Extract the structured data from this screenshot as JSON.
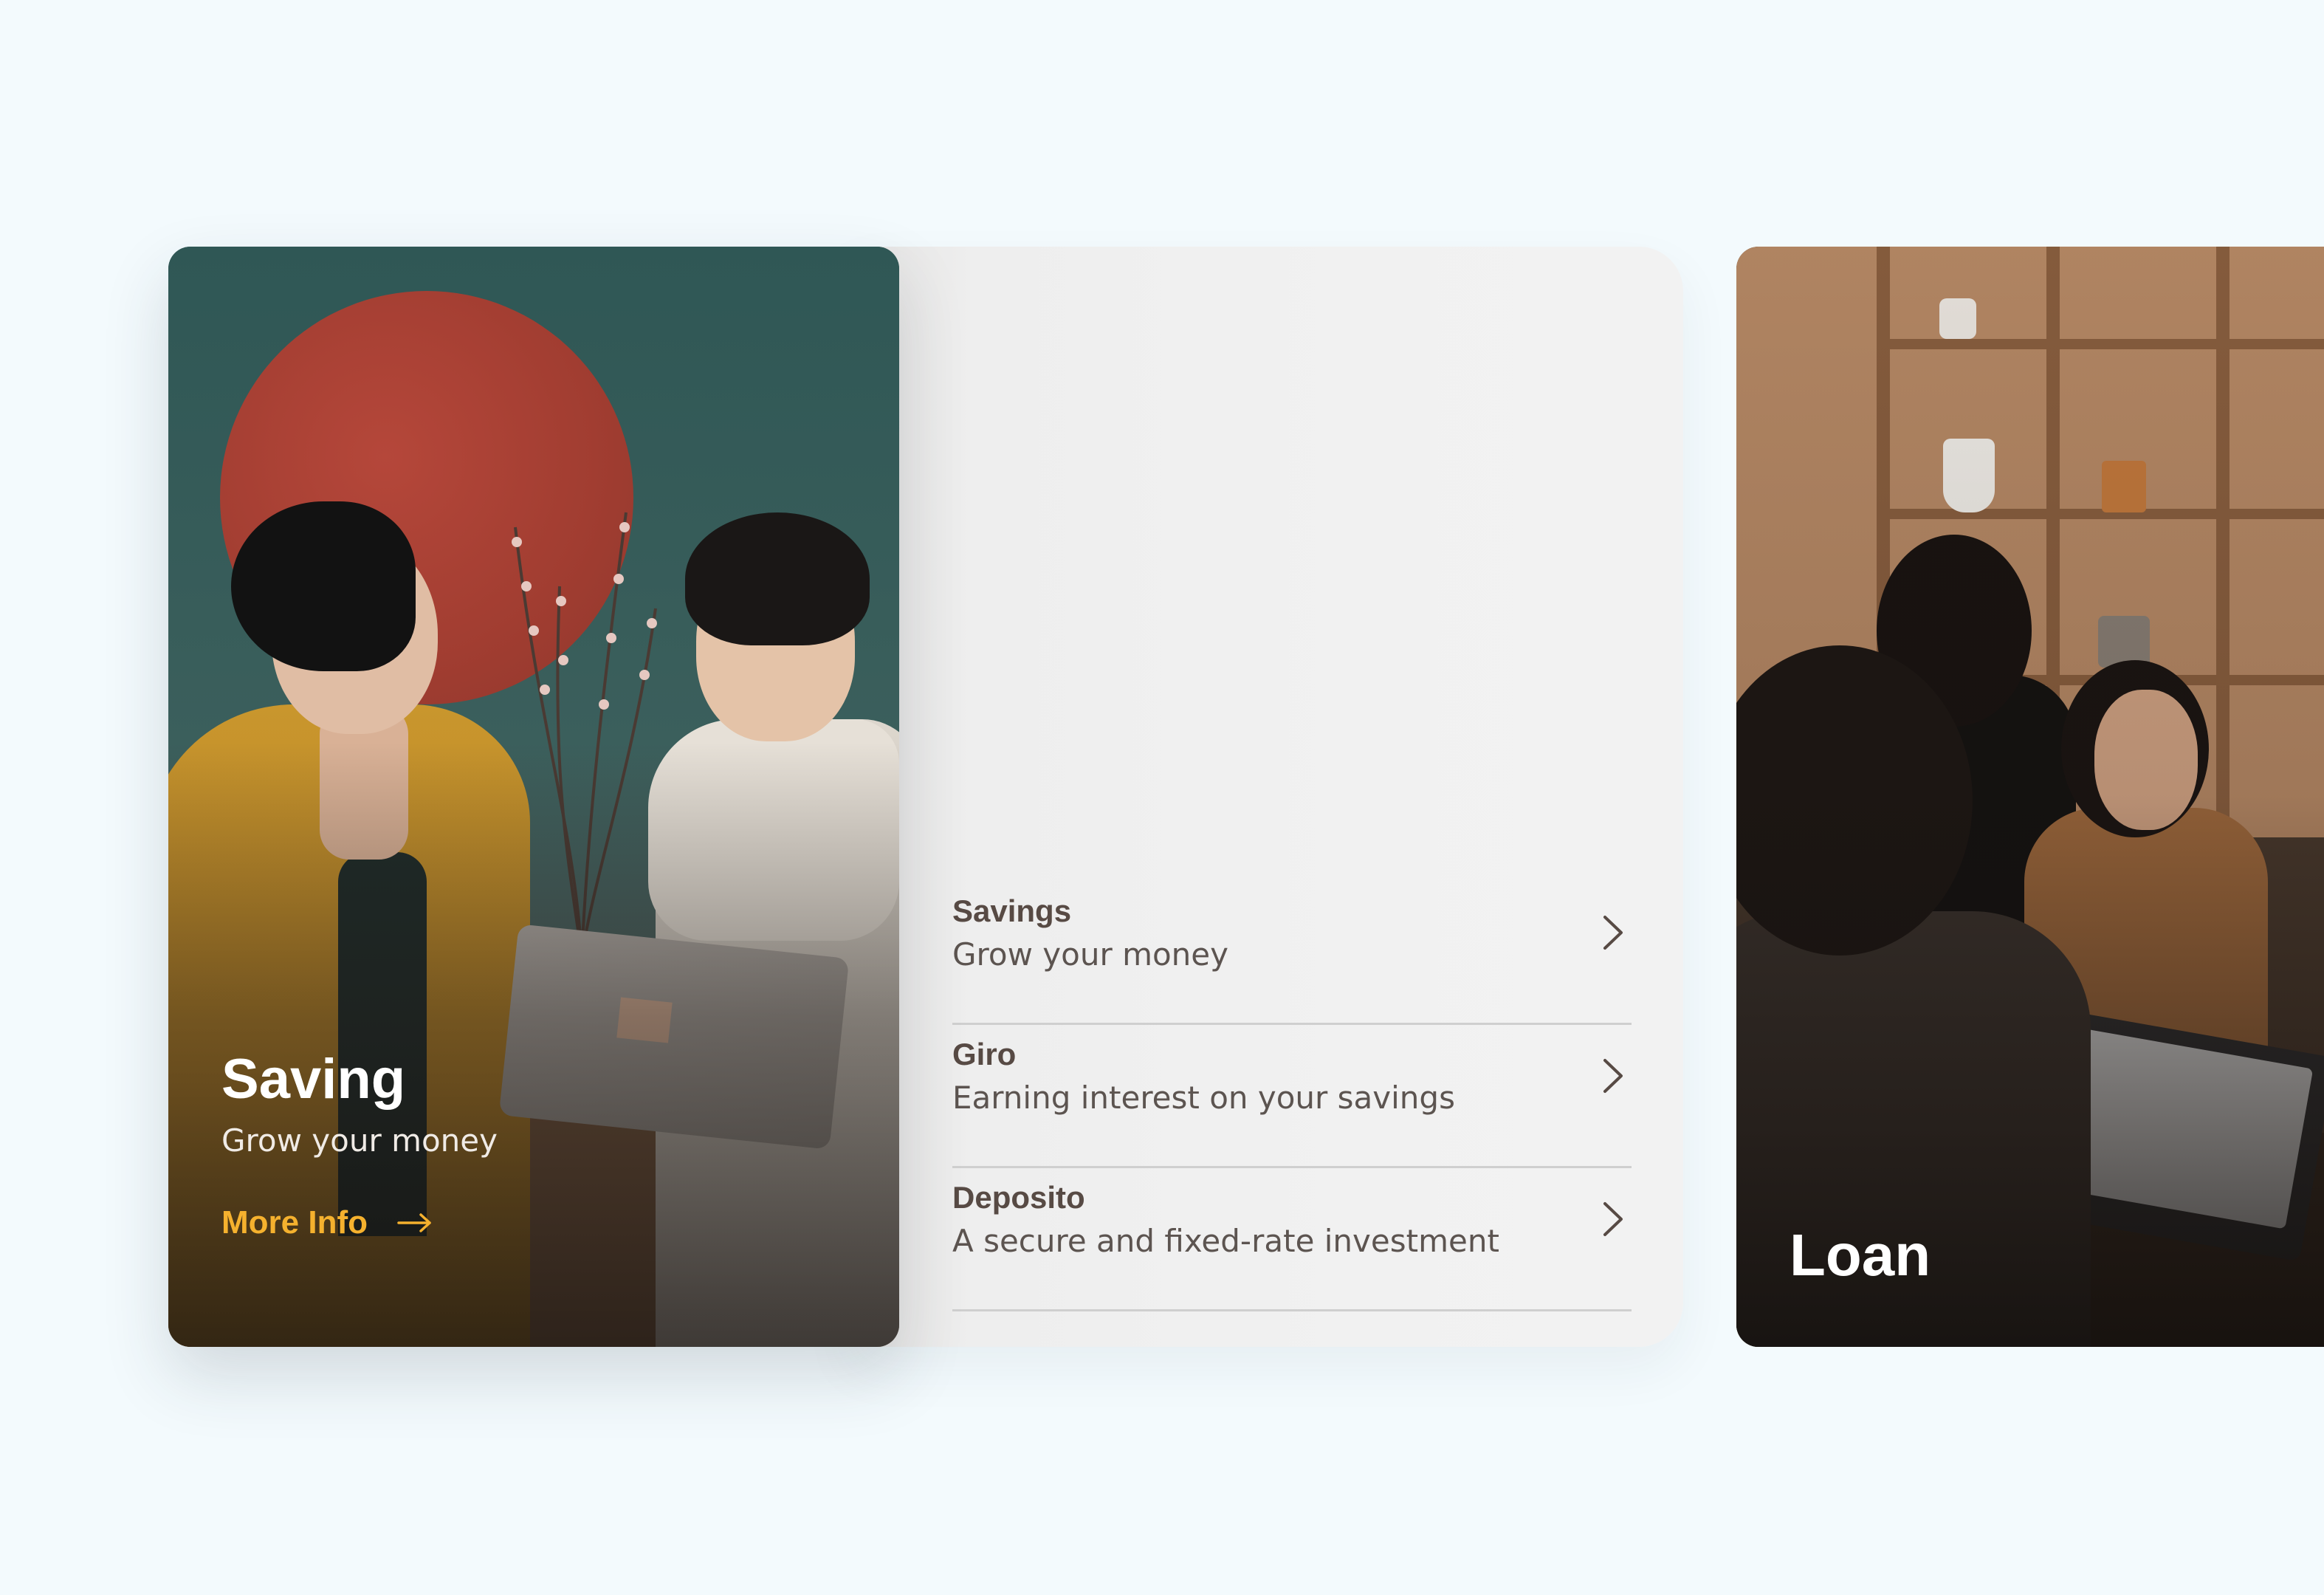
{
  "feature_card": {
    "title": "Saving",
    "subtitle": "Grow your money",
    "cta_label": "More Info",
    "cta_color": "#f5b12e"
  },
  "products": [
    {
      "name": "Savings",
      "description": "Grow your money"
    },
    {
      "name": "Giro",
      "description": "Earning interest on your savings"
    },
    {
      "name": "Deposito",
      "description": "A secure and fixed-rate investment"
    }
  ],
  "next_card": {
    "title": "Loan"
  },
  "icons": {
    "cta": "arrow-right-icon",
    "row_action": "chevron-right-icon"
  },
  "colors": {
    "background": "#f3fafd",
    "panel": "#f1f1f1",
    "product_text": "#574a44",
    "divider": "#cfcfcf"
  }
}
